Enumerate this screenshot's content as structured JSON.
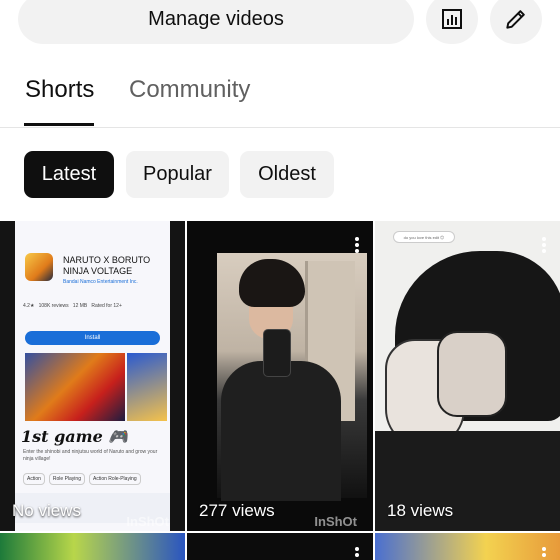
{
  "top_bar": {
    "manage_videos_label": "Manage videos",
    "analytics_icon": "bar-chart-icon",
    "edit_icon": "pencil-icon"
  },
  "tabs": [
    {
      "label": "Shorts",
      "selected": true
    },
    {
      "label": "Community",
      "selected": false
    }
  ],
  "filters": [
    {
      "label": "Latest",
      "selected": true
    },
    {
      "label": "Popular",
      "selected": false
    },
    {
      "label": "Oldest",
      "selected": false
    }
  ],
  "shorts": [
    {
      "views": "No views",
      "watermark": "InShOt",
      "thumbnail": {
        "app_name": "NARUTO X BORUTO NINJA VOLTAGE",
        "developer": "Bandai Namco Entertainment Inc.",
        "in_app": "In-app purchases",
        "rating": "4.2★",
        "reviews": "108K reviews",
        "size": "12 MB",
        "age": "Rated for 12+",
        "install_label": "Install",
        "overlay_text": "1st game 🎮",
        "description": "Enter the shinobi and ninjutsu world of Naruto and grow your ninja village!",
        "tags": [
          "Action",
          "Role Playing",
          "Action Role-Playing"
        ]
      }
    },
    {
      "views": "277 views",
      "watermark": "InShOt"
    },
    {
      "views": "18 views",
      "thumbnail": {
        "bubble_text": "do you love this edit 😊"
      }
    }
  ],
  "colors": {
    "accent": "#0f0f0f",
    "chip_bg": "#f2f2f2",
    "muted_text": "#606060",
    "divider": "#e5e5e5"
  }
}
